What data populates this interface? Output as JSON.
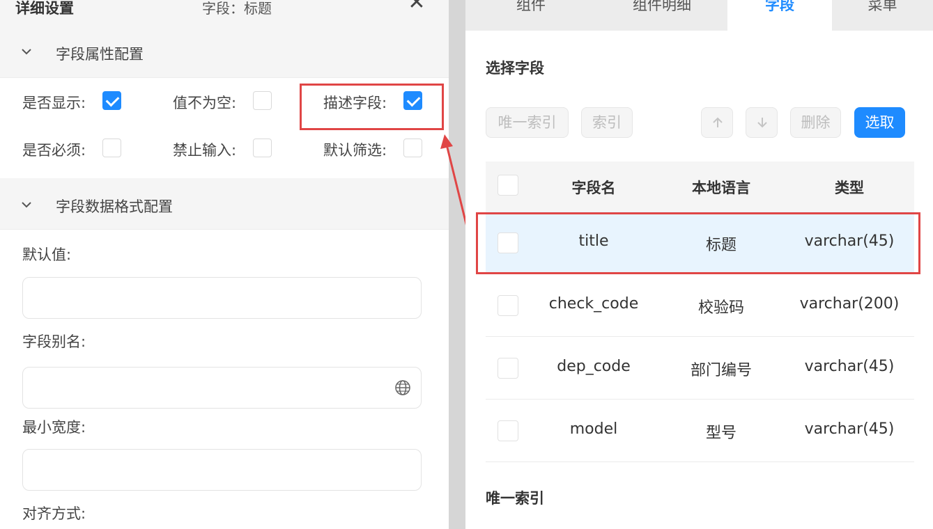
{
  "left": {
    "header": {
      "title": "详细设置",
      "subtitle": "字段：标题",
      "close_icon": "close-icon"
    },
    "section1": {
      "label": "字段属性配置"
    },
    "checkboxes": [
      {
        "label": "是否显示:",
        "checked": true
      },
      {
        "label": "值不为空:",
        "checked": false
      },
      {
        "label": "描述字段:",
        "checked": true
      },
      {
        "label": "是否必须:",
        "checked": false
      },
      {
        "label": "禁止输入:",
        "checked": false
      },
      {
        "label": "默认筛选:",
        "checked": false
      }
    ],
    "section2": {
      "label": "字段数据格式配置"
    },
    "fields": [
      {
        "label": "默认值:",
        "value": ""
      },
      {
        "label": "字段别名:",
        "value": ""
      },
      {
        "label": "最小宽度:",
        "value": ""
      },
      {
        "label": "对齐方式:"
      }
    ]
  },
  "right": {
    "tabs": [
      {
        "label": "组件",
        "active": false
      },
      {
        "label": "组件明细",
        "active": false
      },
      {
        "label": "字段",
        "active": true
      },
      {
        "label": "菜单",
        "active": false
      }
    ],
    "select_title": "选择字段",
    "toolbar": {
      "unique_index": "唯一索引",
      "index": "索引",
      "up_icon": "arrow-up-icon",
      "down_icon": "arrow-down-icon",
      "delete": "删除",
      "select": "选取"
    },
    "table": {
      "headers": [
        "字段名",
        "本地语言",
        "类型"
      ],
      "rows": [
        {
          "name": "title",
          "local": "标题",
          "type": "varchar(45)",
          "selected": true
        },
        {
          "name": "check_code",
          "local": "校验码",
          "type": "varchar(200)",
          "selected": false
        },
        {
          "name": "dep_code",
          "local": "部门编号",
          "type": "varchar(45)",
          "selected": false
        },
        {
          "name": "model",
          "local": "型号",
          "type": "varchar(45)",
          "selected": false
        }
      ]
    },
    "unique_title": "唯一索引"
  },
  "colors": {
    "accent": "#1e8bff",
    "highlight": "#e04545"
  }
}
